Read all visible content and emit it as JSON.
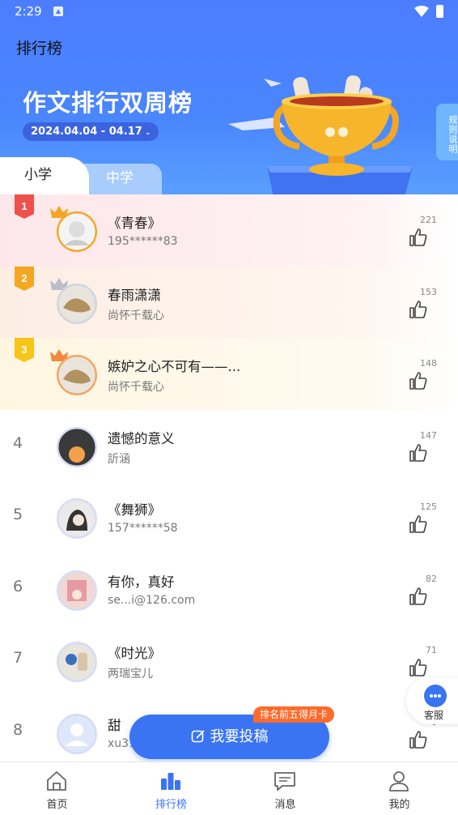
{
  "status_bar": {
    "time": "2:29"
  },
  "header": {
    "app_title": "排行榜",
    "board_title": "作文排行双周榜",
    "date_range": "2024.04.04 - 04.17",
    "rules_label": "规则说明"
  },
  "tabs": [
    {
      "label": "小学",
      "active": true
    },
    {
      "label": "中学",
      "active": false
    }
  ],
  "ranking": [
    {
      "rank": "1",
      "title": "《青春》",
      "author": "195******83",
      "likes": "221"
    },
    {
      "rank": "2",
      "title": "春雨潇潇",
      "author": "尚怀千载心",
      "likes": "153"
    },
    {
      "rank": "3",
      "title": "嫉妒之心不可有——...",
      "author": "尚怀千载心",
      "likes": "148"
    },
    {
      "rank": "4",
      "title": "遗憾的意义",
      "author": "訢涵",
      "likes": "147"
    },
    {
      "rank": "5",
      "title": "《舞狮》",
      "author": "157******58",
      "likes": "125"
    },
    {
      "rank": "6",
      "title": "有你，真好",
      "author": "se...i@126.com",
      "likes": "82"
    },
    {
      "rank": "7",
      "title": "《时光》",
      "author": "两瑞宝儿",
      "likes": "71"
    },
    {
      "rank": "8",
      "title": "甜",
      "author": "xu31",
      "likes": "6"
    }
  ],
  "customer_service": {
    "label": "客服"
  },
  "submit_button": {
    "label": "我要投稿",
    "promo": "排名前五得月卡"
  },
  "bottom_nav": [
    {
      "label": "首页",
      "icon": "home-icon"
    },
    {
      "label": "排行榜",
      "icon": "ranking-icon"
    },
    {
      "label": "消息",
      "icon": "message-icon"
    },
    {
      "label": "我的",
      "icon": "profile-icon"
    }
  ],
  "colors": {
    "primary": "#3a74f3",
    "hero": "#4c7dff",
    "gold": "#f5a623",
    "rank1": "#f0504a",
    "rank2": "#f5a623",
    "rank3": "#f5c518",
    "promo": "#ff6a2b"
  }
}
